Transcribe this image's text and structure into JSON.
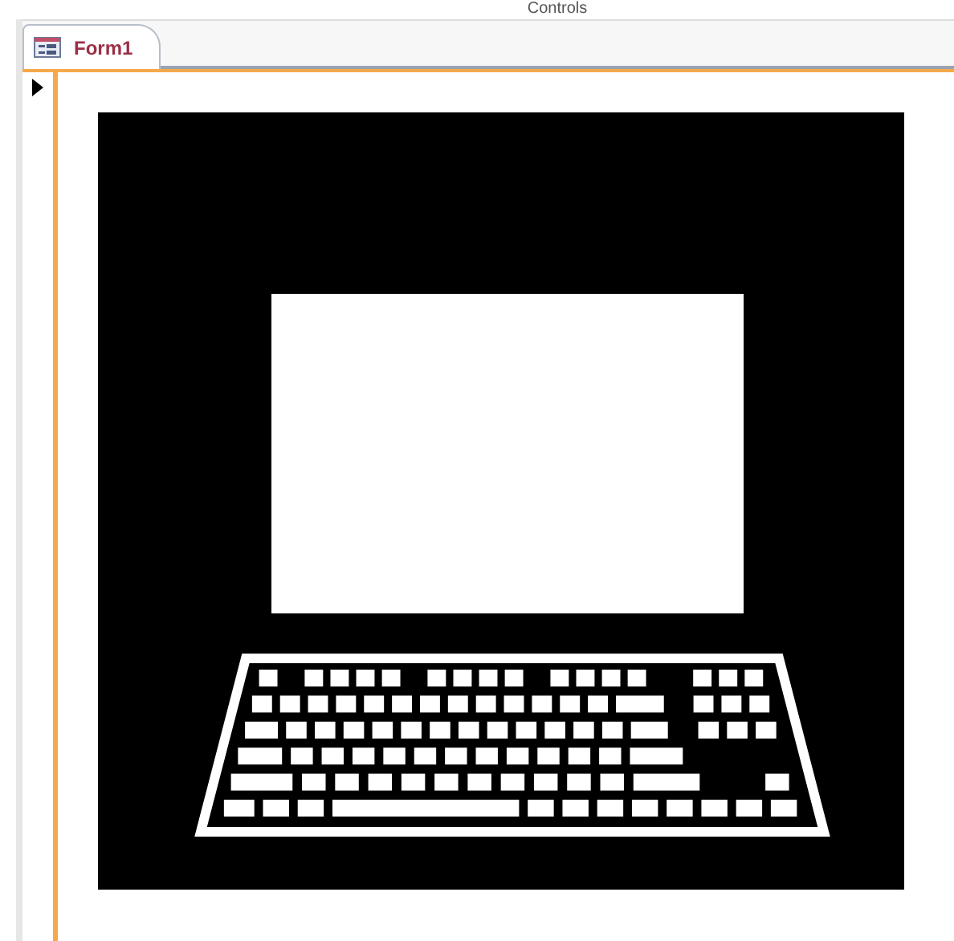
{
  "window": {
    "title": "Controls"
  },
  "tabs": [
    {
      "label": "Form1",
      "selected": true
    }
  ]
}
